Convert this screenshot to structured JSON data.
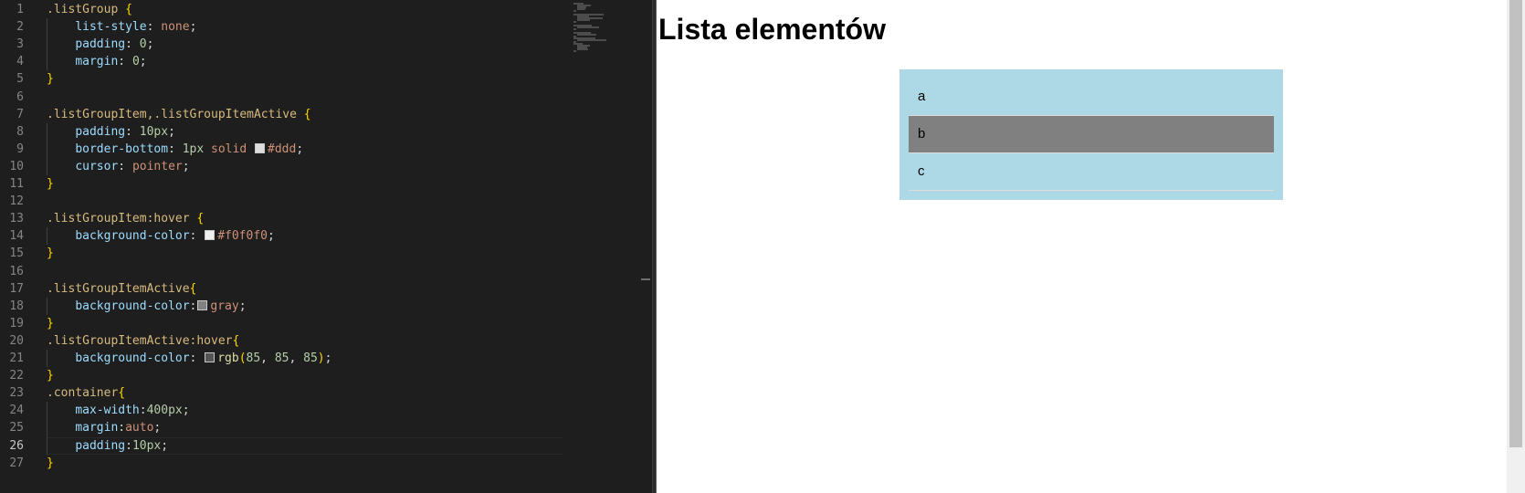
{
  "editor": {
    "lines": [
      {
        "n": "1",
        "tokens": [
          [
            "sel",
            ".listGroup "
          ],
          [
            "brace",
            "{"
          ]
        ]
      },
      {
        "n": "2",
        "tokens": [
          [
            "punc",
            "    "
          ],
          [
            "prop",
            "list-style"
          ],
          [
            "punc",
            ": "
          ],
          [
            "val",
            "none"
          ],
          [
            "punc",
            ";"
          ]
        ]
      },
      {
        "n": "3",
        "tokens": [
          [
            "punc",
            "    "
          ],
          [
            "prop",
            "padding"
          ],
          [
            "punc",
            ": "
          ],
          [
            "num",
            "0"
          ],
          [
            "punc",
            ";"
          ]
        ]
      },
      {
        "n": "4",
        "tokens": [
          [
            "punc",
            "    "
          ],
          [
            "prop",
            "margin"
          ],
          [
            "punc",
            ": "
          ],
          [
            "num",
            "0"
          ],
          [
            "punc",
            ";"
          ]
        ]
      },
      {
        "n": "5",
        "tokens": [
          [
            "brace",
            "}"
          ]
        ]
      },
      {
        "n": "6",
        "tokens": []
      },
      {
        "n": "7",
        "tokens": [
          [
            "sel",
            ".listGroupItem,.listGroupItemActive "
          ],
          [
            "brace",
            "{"
          ]
        ]
      },
      {
        "n": "8",
        "tokens": [
          [
            "punc",
            "    "
          ],
          [
            "prop",
            "padding"
          ],
          [
            "punc",
            ": "
          ],
          [
            "num",
            "10px"
          ],
          [
            "punc",
            ";"
          ]
        ]
      },
      {
        "n": "9",
        "tokens": [
          [
            "punc",
            "    "
          ],
          [
            "prop",
            "border-bottom"
          ],
          [
            "punc",
            ": "
          ],
          [
            "num",
            "1px"
          ],
          [
            "punc",
            " "
          ],
          [
            "val",
            "solid"
          ],
          [
            "punc",
            " "
          ],
          [
            "swatch",
            "#dddddd"
          ],
          [
            "val",
            "#ddd"
          ],
          [
            "punc",
            ";"
          ]
        ]
      },
      {
        "n": "10",
        "tokens": [
          [
            "punc",
            "    "
          ],
          [
            "prop",
            "cursor"
          ],
          [
            "punc",
            ": "
          ],
          [
            "val",
            "pointer"
          ],
          [
            "punc",
            ";"
          ]
        ]
      },
      {
        "n": "11",
        "tokens": [
          [
            "brace",
            "}"
          ]
        ]
      },
      {
        "n": "12",
        "tokens": []
      },
      {
        "n": "13",
        "tokens": [
          [
            "sel",
            ".listGroupItem:hover "
          ],
          [
            "brace",
            "{"
          ]
        ]
      },
      {
        "n": "14",
        "tokens": [
          [
            "punc",
            "    "
          ],
          [
            "prop",
            "background-color"
          ],
          [
            "punc",
            ": "
          ],
          [
            "swatch",
            "#f0f0f0"
          ],
          [
            "val",
            "#f0f0f0"
          ],
          [
            "punc",
            ";"
          ]
        ]
      },
      {
        "n": "15",
        "tokens": [
          [
            "brace",
            "}"
          ]
        ]
      },
      {
        "n": "16",
        "tokens": []
      },
      {
        "n": "17",
        "tokens": [
          [
            "sel",
            ".listGroupItemActive"
          ],
          [
            "brace",
            "{"
          ]
        ]
      },
      {
        "n": "18",
        "tokens": [
          [
            "punc",
            "    "
          ],
          [
            "prop",
            "background-color"
          ],
          [
            "punc",
            ":"
          ],
          [
            "swatch",
            "#808080"
          ],
          [
            "val",
            "gray"
          ],
          [
            "punc",
            ";"
          ]
        ]
      },
      {
        "n": "19",
        "tokens": [
          [
            "brace",
            "}"
          ]
        ]
      },
      {
        "n": "20",
        "tokens": [
          [
            "sel",
            ".listGroupItemActive:hover"
          ],
          [
            "brace",
            "{"
          ]
        ]
      },
      {
        "n": "21",
        "tokens": [
          [
            "punc",
            "    "
          ],
          [
            "prop",
            "background-color"
          ],
          [
            "punc",
            ": "
          ],
          [
            "swatch",
            "#555555"
          ],
          [
            "fn",
            "rgb"
          ],
          [
            "brace",
            "("
          ],
          [
            "num",
            "85"
          ],
          [
            "punc",
            ", "
          ],
          [
            "num",
            "85"
          ],
          [
            "punc",
            ", "
          ],
          [
            "num",
            "85"
          ],
          [
            "brace",
            ")"
          ],
          [
            "punc",
            ";"
          ]
        ]
      },
      {
        "n": "22",
        "tokens": [
          [
            "brace",
            "}"
          ]
        ]
      },
      {
        "n": "23",
        "tokens": [
          [
            "sel",
            ".container"
          ],
          [
            "brace",
            "{"
          ]
        ]
      },
      {
        "n": "24",
        "tokens": [
          [
            "punc",
            "    "
          ],
          [
            "prop",
            "max-width"
          ],
          [
            "punc",
            ":"
          ],
          [
            "num",
            "400px"
          ],
          [
            "punc",
            ";"
          ]
        ]
      },
      {
        "n": "25",
        "tokens": [
          [
            "punc",
            "    "
          ],
          [
            "prop",
            "margin"
          ],
          [
            "punc",
            ":"
          ],
          [
            "val",
            "auto"
          ],
          [
            "punc",
            ";"
          ]
        ]
      },
      {
        "n": "26",
        "tokens": [
          [
            "punc",
            "    "
          ],
          [
            "prop",
            "padding"
          ],
          [
            "punc",
            ":"
          ],
          [
            "num",
            "10px"
          ],
          [
            "punc",
            ";"
          ]
        ]
      },
      {
        "n": "27",
        "tokens": [
          [
            "brace",
            "}"
          ]
        ]
      }
    ],
    "active_line": "26"
  },
  "preview": {
    "title": "Lista elementów",
    "items": [
      {
        "label": "a",
        "active": false
      },
      {
        "label": "b",
        "active": true
      },
      {
        "label": "c",
        "active": false
      }
    ]
  },
  "colors": {
    "editor_bg": "#1e1e1e",
    "container_bg": "#add8e6",
    "active_item_bg": "#808080",
    "item_border": "#dddddd"
  }
}
